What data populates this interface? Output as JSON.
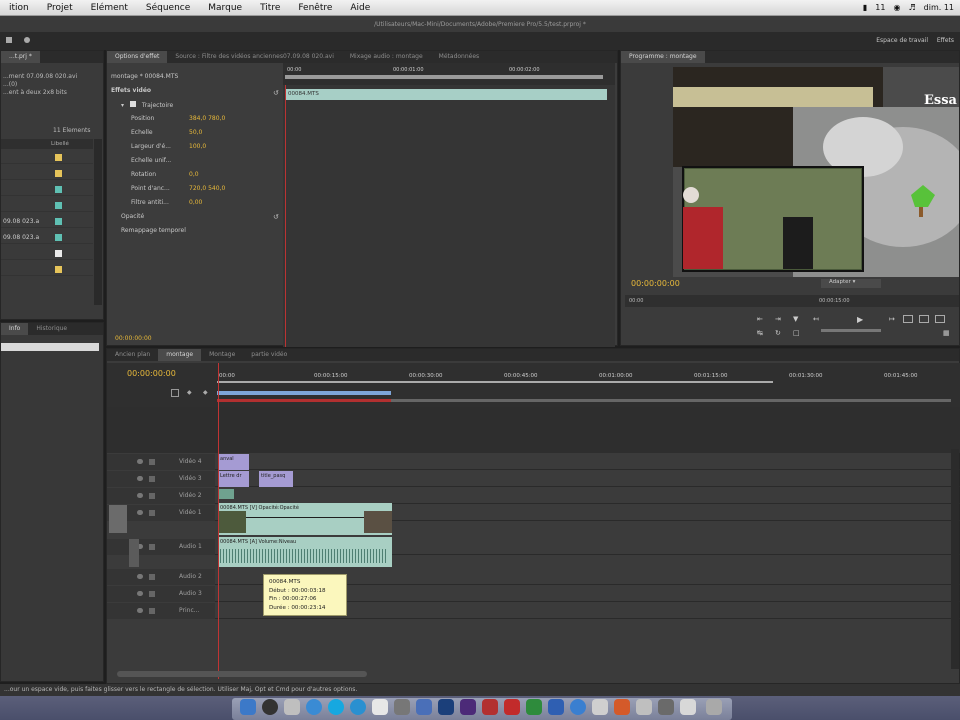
{
  "menubar": {
    "items": [
      "ition",
      "Projet",
      "Elément",
      "Séquence",
      "Marque",
      "Titre",
      "Fenêtre",
      "Aide"
    ],
    "clock": "dim. 11",
    "battery_label": "11"
  },
  "window": {
    "title": "/Utilisateurs/Mac-Mini/Documents/Adobe/Premiere Pro/5.5/test.prproj *",
    "workspace_label": "Espace de travail",
    "effects_label": "Effets"
  },
  "project": {
    "filename": "...t.prj *",
    "clip_title": "...ment 07.09.08 020.avi",
    "info1": "...(0)",
    "info2": "...ent à deux 2x8 bits",
    "count": "11 Elements",
    "col_label": "Libellé",
    "rows": [
      {
        "name": "",
        "color": "#e6c45a"
      },
      {
        "name": "",
        "color": "#e6c45a"
      },
      {
        "name": "",
        "color": "#5fc0b3"
      },
      {
        "name": "",
        "color": "#5fc0b3"
      },
      {
        "name": "09.08 023.a",
        "color": "#5fc0b3"
      },
      {
        "name": "09.08 023.a",
        "color": "#5fc0b3"
      },
      {
        "name": "",
        "color": "#e9e9e9"
      },
      {
        "name": "",
        "color": "#e6c45a"
      }
    ],
    "bottom_tab_1": "Info",
    "bottom_tab_2": "Historique"
  },
  "effect_options": {
    "tabs": [
      "Options d'effet",
      "Source : Filtre des vidéos anciennes07.09.08 020.avi",
      "Mixage audio : montage",
      "Métadonnées"
    ],
    "sequence_label": "montage * 00084.MTS",
    "section": "Effets vidéo",
    "motion_label": "Trajectoire",
    "params": [
      {
        "label": "Position",
        "value": "384,0   780,0"
      },
      {
        "label": "Echelle",
        "value": "50,0"
      },
      {
        "label": "Largeur d'é...",
        "value": "100,0"
      },
      {
        "label": "Echelle unif...",
        "value": ""
      },
      {
        "label": "Rotation",
        "value": "0,0"
      },
      {
        "label": "Point d'anc...",
        "value": "720,0   540,0"
      },
      {
        "label": "Filtre antiti...",
        "value": "0,00"
      }
    ],
    "opacity_label": "Opacité",
    "remap_label": "Remappage temporel",
    "clip_label": "00084.MTS",
    "ruler_times": [
      "00:00",
      "00:00:01:00",
      "00:00:02:00"
    ],
    "timecode": "00:00:00:00"
  },
  "program": {
    "tab": "Programme : montage",
    "timecode": "00:00:00:00",
    "fit": "Adapter",
    "ruler_left": "00:00",
    "ruler_mid": "00:00:15:00",
    "video_text": "Essa"
  },
  "timeline": {
    "tabs": [
      "Ancien plan",
      "montage",
      "Montage",
      "partie vidéo"
    ],
    "timecode": "00:00:00:00",
    "ruler_times": [
      "00:00",
      "00:00:15:00",
      "00:00:30:00",
      "00:00:45:00",
      "00:01:00:00",
      "00:01:15:00",
      "00:01:30:00",
      "00:01:45:00"
    ],
    "tracks": [
      {
        "name": "Vidéo 4"
      },
      {
        "name": "Vidéo 3"
      },
      {
        "name": "Vidéo 2"
      },
      {
        "name": "Vidéo 1"
      },
      {
        "name": "Audio 1"
      },
      {
        "name": "Audio 2"
      },
      {
        "name": "Audio 3"
      },
      {
        "name": "Princ..."
      }
    ],
    "clips": {
      "v4": "anval",
      "v3a": "Lettre dr",
      "v3b": "title_pasq",
      "v1": "00084.MTS [V]  Opacité:Opacité",
      "a1": "00084.MTS [A]  Volume:Niveau"
    }
  },
  "tooltip": {
    "title": "00084.MTS",
    "start": "Début : 00:00:03:18",
    "end": "Fin : 00:00:27:06",
    "duration": "Durée : 00:00:23:14"
  },
  "status": "...our un espace vide, puis faites glisser vers le rectangle de sélection. Utiliser Maj, Opt et Cmd pour d'autres options."
}
